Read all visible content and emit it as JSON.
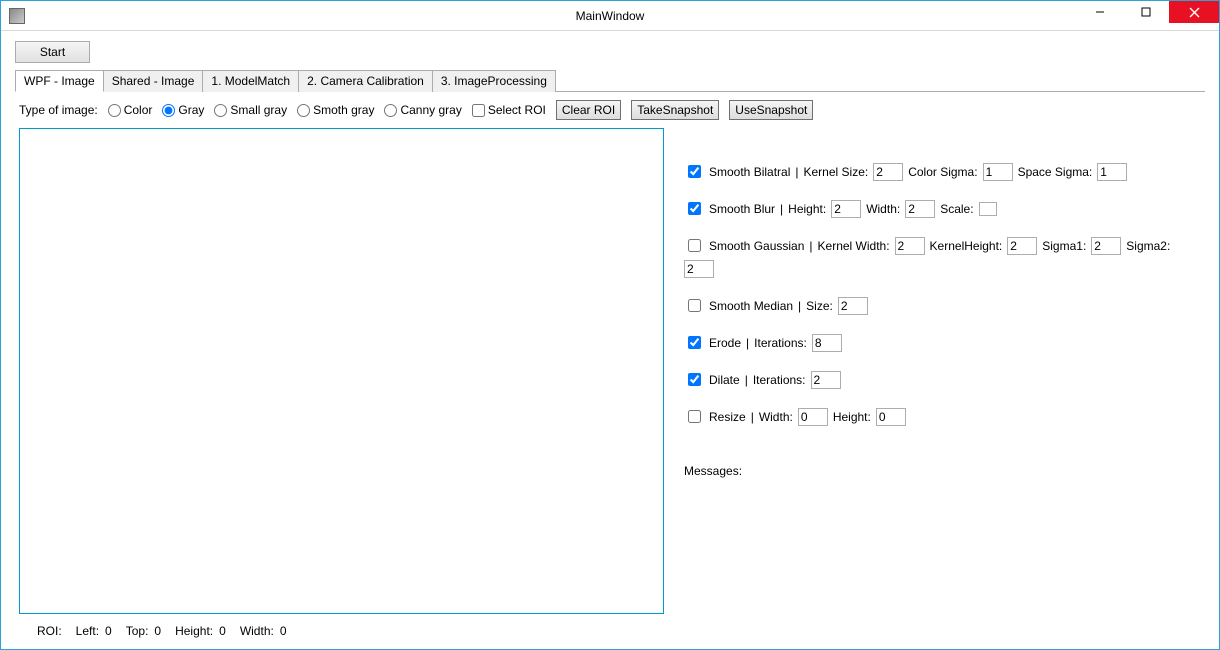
{
  "window": {
    "title": "MainWindow"
  },
  "toolbar": {
    "start": "Start"
  },
  "tabs": [
    "WPF - Image",
    "Shared - Image",
    "1. ModelMatch",
    "2. Camera Calibration",
    "3. ImageProcessing"
  ],
  "typerow": {
    "label": "Type of image:",
    "options": {
      "color": "Color",
      "gray": "Gray",
      "smallgray": "Small gray",
      "smothgray": "Smoth gray",
      "cannygray": "Canny gray"
    },
    "selected": "gray",
    "selectroi": "Select ROI",
    "clearroi": "Clear ROI",
    "takesnap": "TakeSnapshot",
    "usesnap": "UseSnapshot"
  },
  "ops": {
    "bilateral": {
      "label": "Smooth Bilatral",
      "checked": true,
      "kernel_label": "Kernel Size:",
      "kernel": "2",
      "colorsig_label": "Color Sigma:",
      "colorsig": "1",
      "spacesig_label": "Space Sigma:",
      "spacesig": "1"
    },
    "blur": {
      "label": "Smooth Blur",
      "checked": true,
      "height_label": "Height:",
      "height": "2",
      "width_label": "Width:",
      "width": "2",
      "scale_label": "Scale:"
    },
    "gaussian": {
      "label": "Smooth Gaussian",
      "checked": false,
      "kw_label": "Kernel Width:",
      "kw": "2",
      "kh_label": "KernelHeight:",
      "kh": "2",
      "s1_label": "Sigma1:",
      "s1": "2",
      "s2_label": "Sigma2:",
      "s2": "2"
    },
    "median": {
      "label": "Smooth Median",
      "checked": false,
      "size_label": "Size:",
      "size": "2"
    },
    "erode": {
      "label": "Erode",
      "checked": true,
      "iter_label": "Iterations:",
      "iter": "8"
    },
    "dilate": {
      "label": "Dilate",
      "checked": true,
      "iter_label": "Iterations:",
      "iter": "2"
    },
    "resize": {
      "label": "Resize",
      "checked": false,
      "w_label": "Width:",
      "w": "0",
      "h_label": "Height:",
      "h": "0"
    }
  },
  "messages_label": "Messages:",
  "roi": {
    "label": "ROI:",
    "left_label": "Left:",
    "left": "0",
    "top_label": "Top:",
    "top": "0",
    "height_label": "Height:",
    "height": "0",
    "width_label": "Width:",
    "width": "0"
  }
}
